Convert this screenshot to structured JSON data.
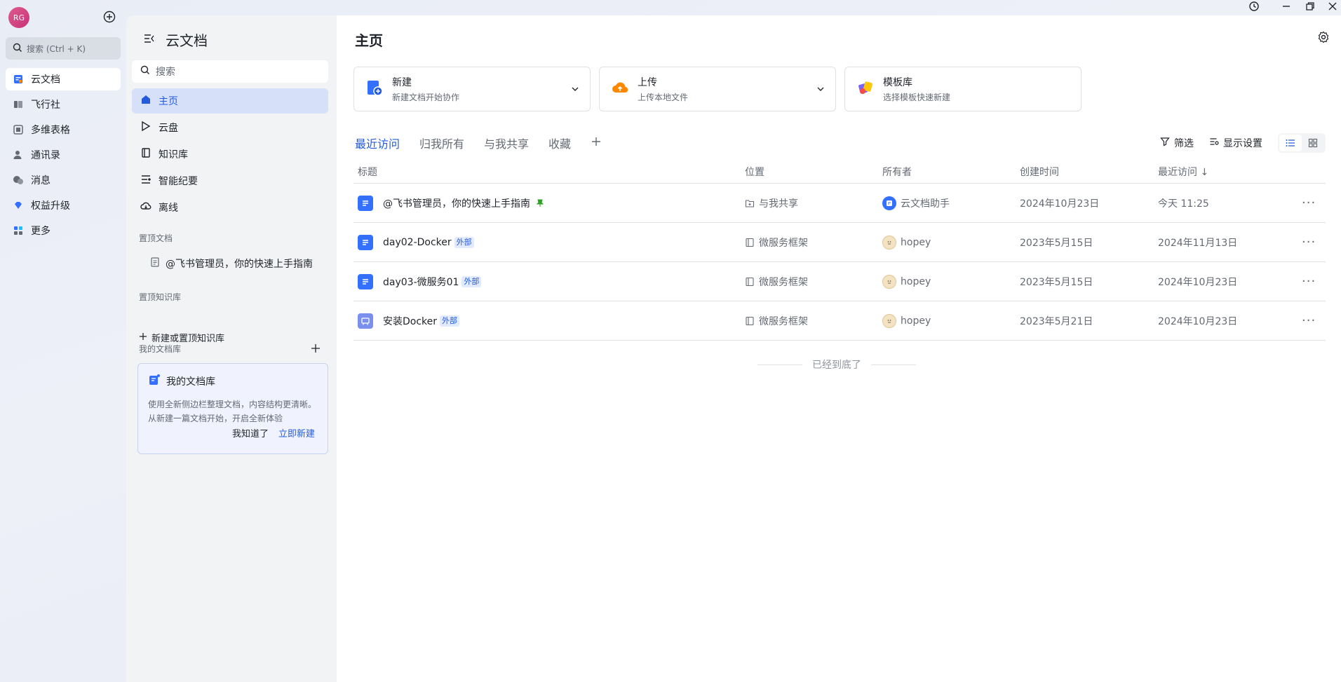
{
  "user": {
    "initials": "RG"
  },
  "rail": {
    "search_placeholder": "搜索 (Ctrl + K)",
    "items": [
      {
        "label": "云文档",
        "icon": "docs-icon"
      },
      {
        "label": "飞行社",
        "icon": "book-icon"
      },
      {
        "label": "多维表格",
        "icon": "base-icon"
      },
      {
        "label": "通讯录",
        "icon": "contacts-icon"
      },
      {
        "label": "消息",
        "icon": "chat-icon"
      },
      {
        "label": "权益升级",
        "icon": "diamond-icon"
      },
      {
        "label": "更多",
        "icon": "grid-icon"
      }
    ]
  },
  "sidebar": {
    "title": "云文档",
    "search_placeholder": "搜索",
    "items": [
      {
        "label": "主页",
        "icon": "home-icon"
      },
      {
        "label": "云盘",
        "icon": "drive-icon"
      },
      {
        "label": "知识库",
        "icon": "wiki-icon"
      },
      {
        "label": "智能纪要",
        "icon": "notes-icon"
      },
      {
        "label": "离线",
        "icon": "offline-icon"
      }
    ],
    "pinned_docs_label": "置顶文档",
    "pinned_doc": "@飞书管理员，你的快速上手指南",
    "pinned_kb_label": "置顶知识库",
    "new_kb": "新建或置顶知识库",
    "my_library_label": "我的文档库",
    "card": {
      "title": "我的文档库",
      "body": "使用全新侧边栏整理文档，内容结构更清晰。从新建一篇文档开始，开启全新体验",
      "dismiss": "我知道了",
      "create": "立即新建"
    }
  },
  "main": {
    "title": "主页",
    "actions": [
      {
        "title": "新建",
        "subtitle": "新建文档开始协作"
      },
      {
        "title": "上传",
        "subtitle": "上传本地文件"
      },
      {
        "title": "模板库",
        "subtitle": "选择模板快速新建"
      }
    ],
    "tabs": [
      "最近访问",
      "归我所有",
      "与我共享",
      "收藏"
    ],
    "filter": "筛选",
    "display_settings": "显示设置",
    "columns": {
      "title": "标题",
      "location": "位置",
      "owner": "所有者",
      "created": "创建时间",
      "last_visit": "最近访问 ↓"
    },
    "rows": [
      {
        "title": "@飞书管理员，你的快速上手指南",
        "external": "",
        "location": "与我共享",
        "owner": "云文档助手",
        "created": "2024年10月23日",
        "last_visit": "今天 11:25"
      },
      {
        "title": "day02-Docker",
        "external": "外部",
        "location": "微服务框架",
        "owner": "hopey",
        "created": "2023年5月15日",
        "last_visit": "2024年11月13日"
      },
      {
        "title": "day03-微服务01",
        "external": "外部",
        "location": "微服务框架",
        "owner": "hopey",
        "created": "2023年5月15日",
        "last_visit": "2024年10月23日"
      },
      {
        "title": "安装Docker",
        "external": "外部",
        "location": "微服务框架",
        "owner": "hopey",
        "created": "2023年5月21日",
        "last_visit": "2024年10月23日"
      }
    ],
    "end_text": "已经到底了"
  },
  "colors": {
    "accent": "#245bdb",
    "doc_blue": "#3370ff",
    "active_bg": "#d6e0f8"
  }
}
